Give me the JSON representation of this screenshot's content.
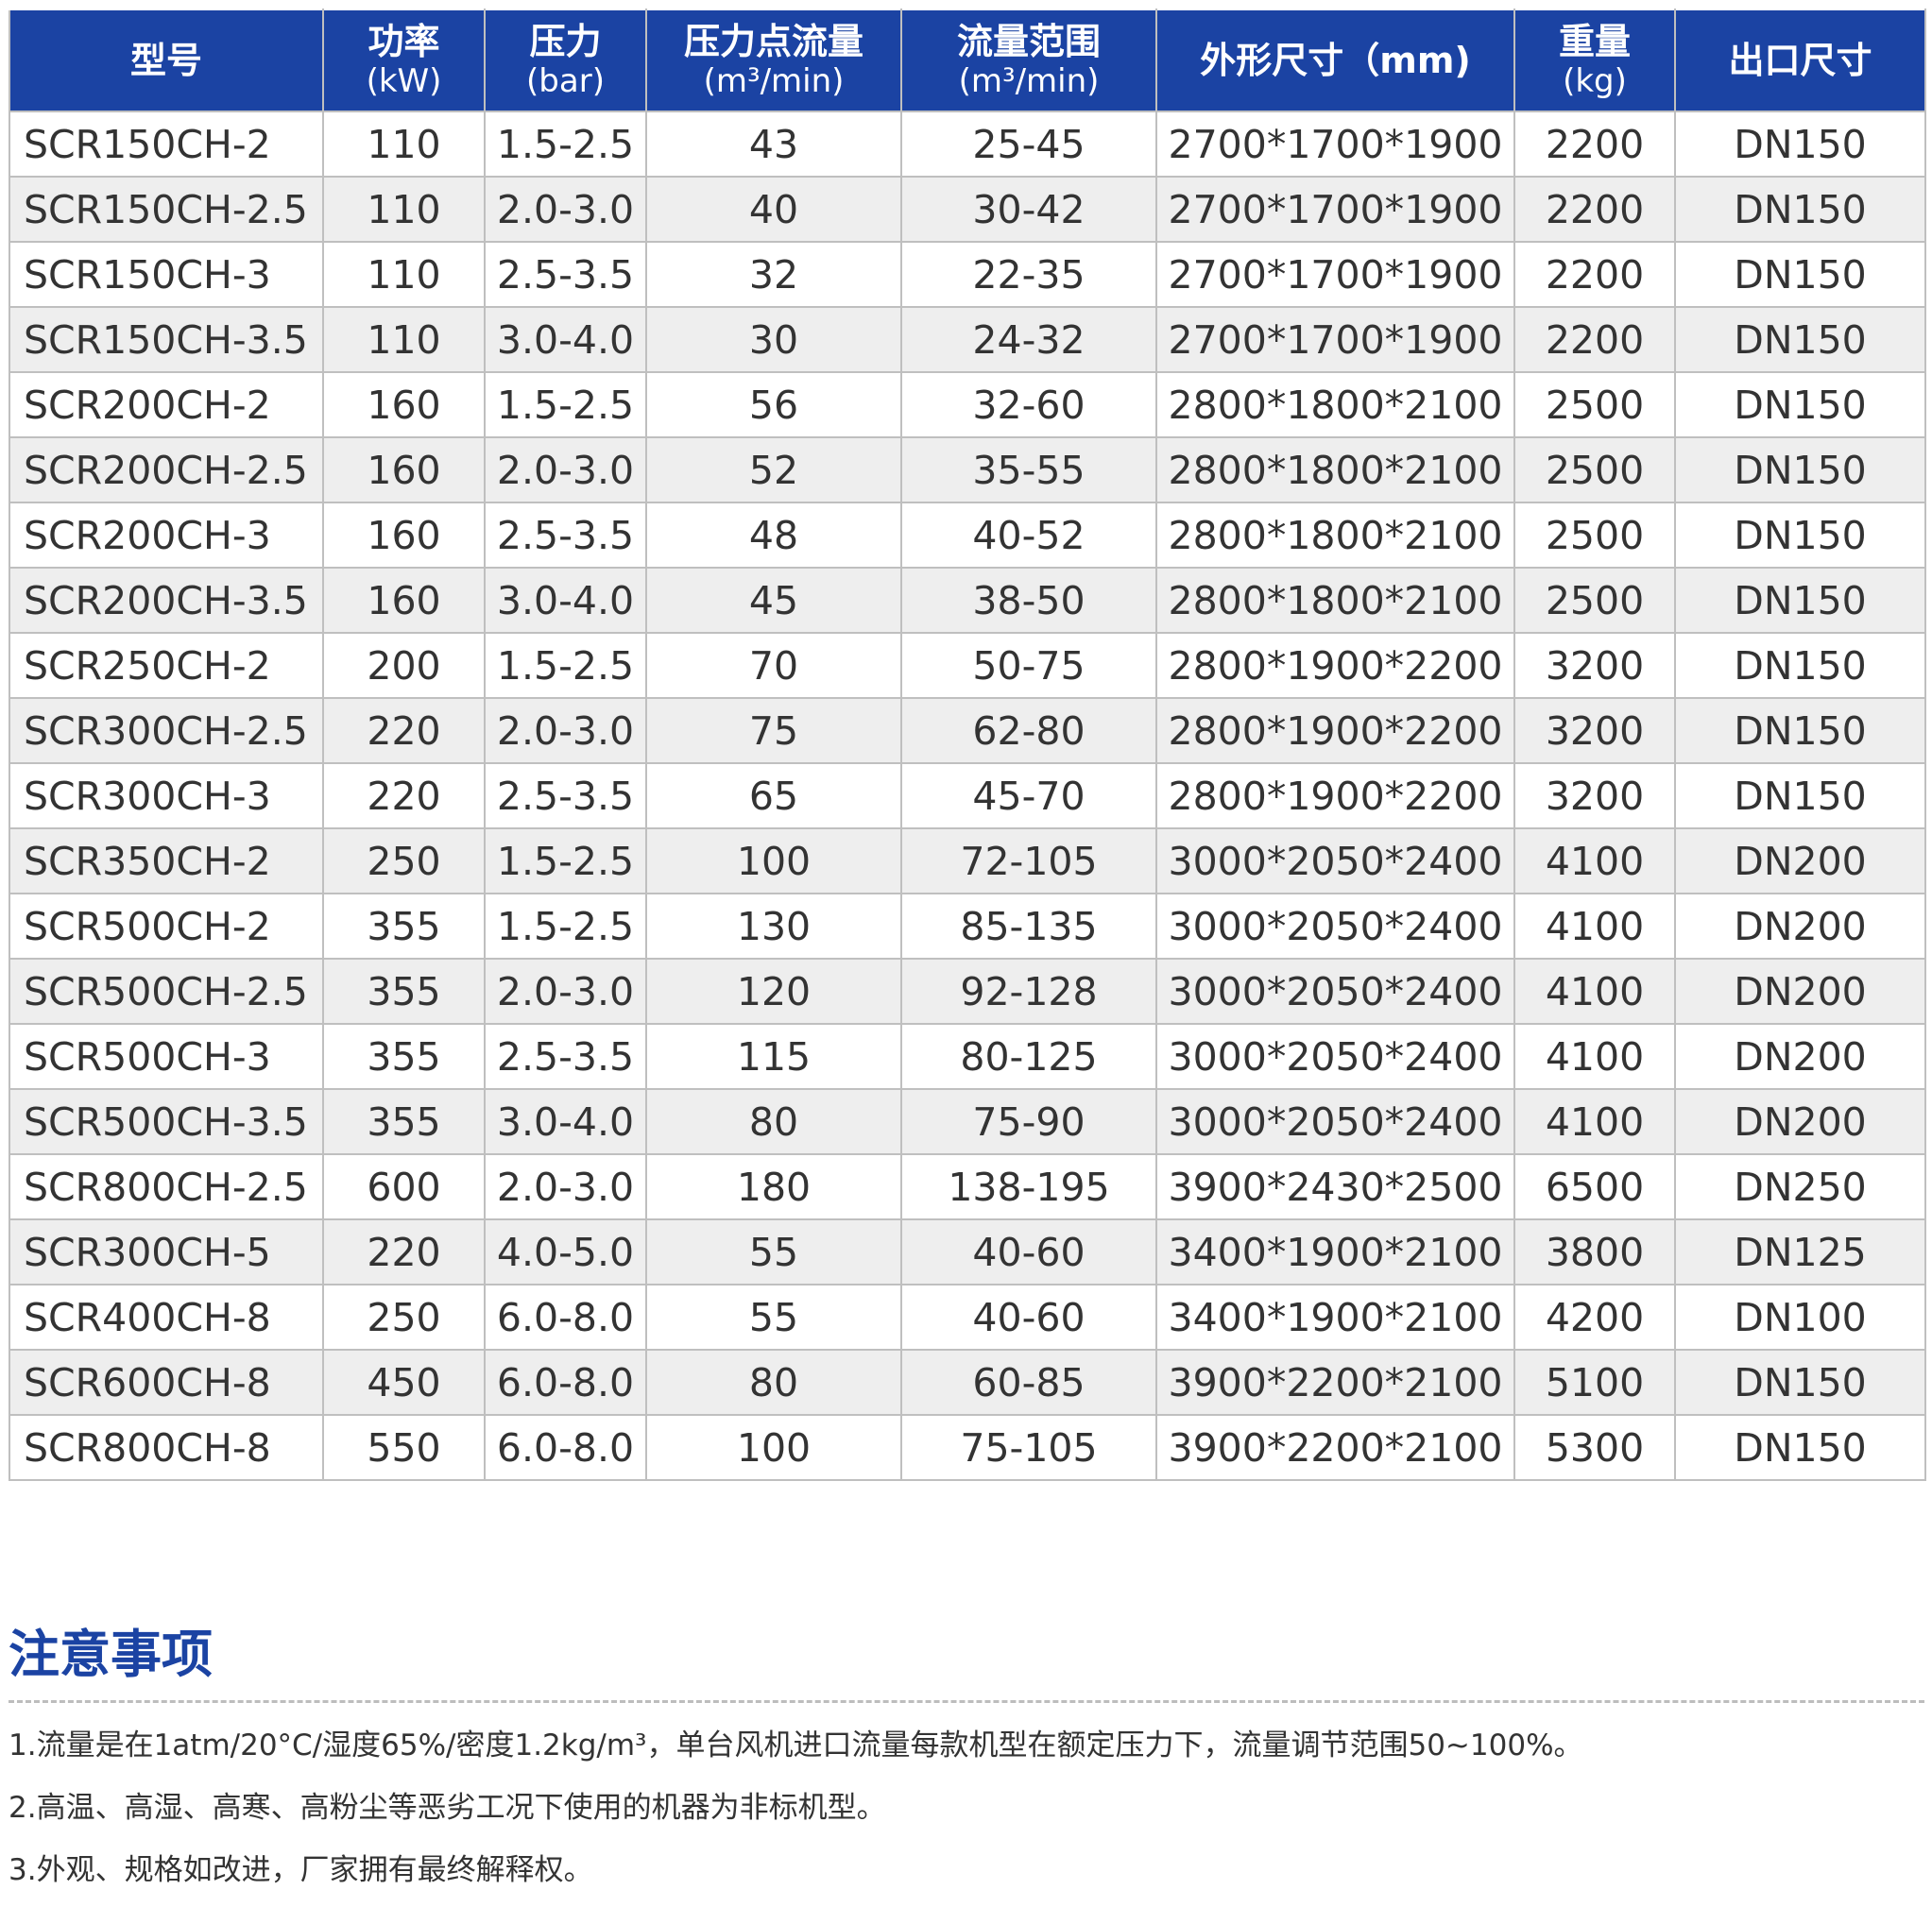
{
  "table": {
    "headers": [
      {
        "title": "型号",
        "unit": ""
      },
      {
        "title": "功率",
        "unit": "(kW)"
      },
      {
        "title": "压力",
        "unit": "(bar)"
      },
      {
        "title": "压力点流量",
        "unit": "(m³/min)"
      },
      {
        "title": "流量范围",
        "unit": "(m³/min)"
      },
      {
        "title": "外形尺寸（mm)",
        "unit": ""
      },
      {
        "title": "重量",
        "unit": "(kg)"
      },
      {
        "title": "出口尺寸",
        "unit": ""
      }
    ],
    "rows": [
      [
        "SCR150CH-2",
        "110",
        "1.5-2.5",
        "43",
        "25-45",
        "2700*1700*1900",
        "2200",
        "DN150"
      ],
      [
        "SCR150CH-2.5",
        "110",
        "2.0-3.0",
        "40",
        "30-42",
        "2700*1700*1900",
        "2200",
        "DN150"
      ],
      [
        "SCR150CH-3",
        "110",
        "2.5-3.5",
        "32",
        "22-35",
        "2700*1700*1900",
        "2200",
        "DN150"
      ],
      [
        "SCR150CH-3.5",
        "110",
        "3.0-4.0",
        "30",
        "24-32",
        "2700*1700*1900",
        "2200",
        "DN150"
      ],
      [
        "SCR200CH-2",
        "160",
        "1.5-2.5",
        "56",
        "32-60",
        "2800*1800*2100",
        "2500",
        "DN150"
      ],
      [
        "SCR200CH-2.5",
        "160",
        "2.0-3.0",
        "52",
        "35-55",
        "2800*1800*2100",
        "2500",
        "DN150"
      ],
      [
        "SCR200CH-3",
        "160",
        "2.5-3.5",
        "48",
        "40-52",
        "2800*1800*2100",
        "2500",
        "DN150"
      ],
      [
        "SCR200CH-3.5",
        "160",
        "3.0-4.0",
        "45",
        "38-50",
        "2800*1800*2100",
        "2500",
        "DN150"
      ],
      [
        "SCR250CH-2",
        "200",
        "1.5-2.5",
        "70",
        "50-75",
        "2800*1900*2200",
        "3200",
        "DN150"
      ],
      [
        "SCR300CH-2.5",
        "220",
        "2.0-3.0",
        "75",
        "62-80",
        "2800*1900*2200",
        "3200",
        "DN150"
      ],
      [
        "SCR300CH-3",
        "220",
        "2.5-3.5",
        "65",
        "45-70",
        "2800*1900*2200",
        "3200",
        "DN150"
      ],
      [
        "SCR350CH-2",
        "250",
        "1.5-2.5",
        "100",
        "72-105",
        "3000*2050*2400",
        "4100",
        "DN200"
      ],
      [
        "SCR500CH-2",
        "355",
        "1.5-2.5",
        "130",
        "85-135",
        "3000*2050*2400",
        "4100",
        "DN200"
      ],
      [
        "SCR500CH-2.5",
        "355",
        "2.0-3.0",
        "120",
        "92-128",
        "3000*2050*2400",
        "4100",
        "DN200"
      ],
      [
        "SCR500CH-3",
        "355",
        "2.5-3.5",
        "115",
        "80-125",
        "3000*2050*2400",
        "4100",
        "DN200"
      ],
      [
        "SCR500CH-3.5",
        "355",
        "3.0-4.0",
        "80",
        "75-90",
        "3000*2050*2400",
        "4100",
        "DN200"
      ],
      [
        "SCR800CH-2.5",
        "600",
        "2.0-3.0",
        "180",
        "138-195",
        "3900*2430*2500",
        "6500",
        "DN250"
      ],
      [
        "SCR300CH-5",
        "220",
        "4.0-5.0",
        "55",
        "40-60",
        "3400*1900*2100",
        "3800",
        "DN125"
      ],
      [
        "SCR400CH-8",
        "250",
        "6.0-8.0",
        "55",
        "40-60",
        "3400*1900*2100",
        "4200",
        "DN100"
      ],
      [
        "SCR600CH-8",
        "450",
        "6.0-8.0",
        "80",
        "60-85",
        "3900*2200*2100",
        "5100",
        "DN150"
      ],
      [
        "SCR800CH-8",
        "550",
        "6.0-8.0",
        "100",
        "75-105",
        "3900*2200*2100",
        "5300",
        "DN150"
      ]
    ]
  },
  "notes": {
    "title": "注意事项",
    "items": [
      "1.流量是在1atm/20°C/湿度65%/密度1.2kg/m³，单台风机进口流量每款机型在额定压力下，流量调节范围50~100%。",
      "2.高温、高湿、高寒、高粉尘等恶劣工况下使用的机器为非标机型。",
      "3.外观、规格如改进，厂家拥有最终解释权。"
    ]
  },
  "colors": {
    "header_bg": "#1b43a3",
    "header_text": "#ffffff",
    "row_alt_bg": "#eeeeee",
    "border": "#bfbfbf",
    "notes_title": "#1b43a3",
    "body_text": "#333333"
  }
}
